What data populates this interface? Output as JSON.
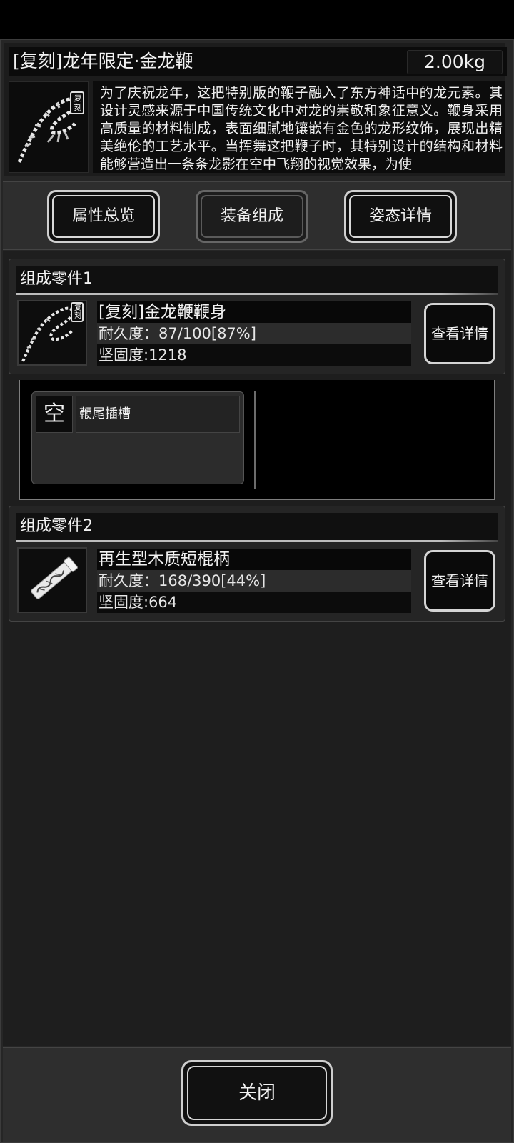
{
  "item": {
    "title": "[复刻]龙年限定·金龙鞭",
    "weight": "2.00kg",
    "badge": "复刻",
    "description": "为了庆祝龙年，这把特别版的鞭子融入了东方神话中的龙元素。其设计灵感来源于中国传统文化中对龙的崇敬和象征意义。鞭身采用高质量的材料制成，表面细腻地镶嵌有金色的龙形纹饰，展现出精美绝伦的工艺水平。当挥舞这把鞭子时，其特别设计的结构和材料能够营造出一条条龙影在空中飞翔的视觉效果，为使"
  },
  "tabs": [
    {
      "label": "属性总览"
    },
    {
      "label": "装备组成"
    },
    {
      "label": "姿态详情"
    }
  ],
  "active_tab": "装备组成",
  "parts": [
    {
      "header": "组成零件1",
      "name": "[复刻]金龙鞭鞭身",
      "durability": "耐久度：87/100[87%]",
      "durability_ratio": 0.87,
      "hardness": "坚固度:1218",
      "badge": "复刻",
      "detail_label": "查看详情",
      "icon": "dragon-whip-icon"
    },
    {
      "header": "组成零件2",
      "name": "再生型木质短棍柄",
      "durability": "耐久度：168/390[44%]",
      "durability_ratio": 0.44,
      "hardness": "坚固度:664",
      "detail_label": "查看详情",
      "icon": "wooden-handle-icon"
    }
  ],
  "slot": {
    "status": "空",
    "label": "鞭尾插槽"
  },
  "footer": {
    "close_label": "关闭"
  }
}
